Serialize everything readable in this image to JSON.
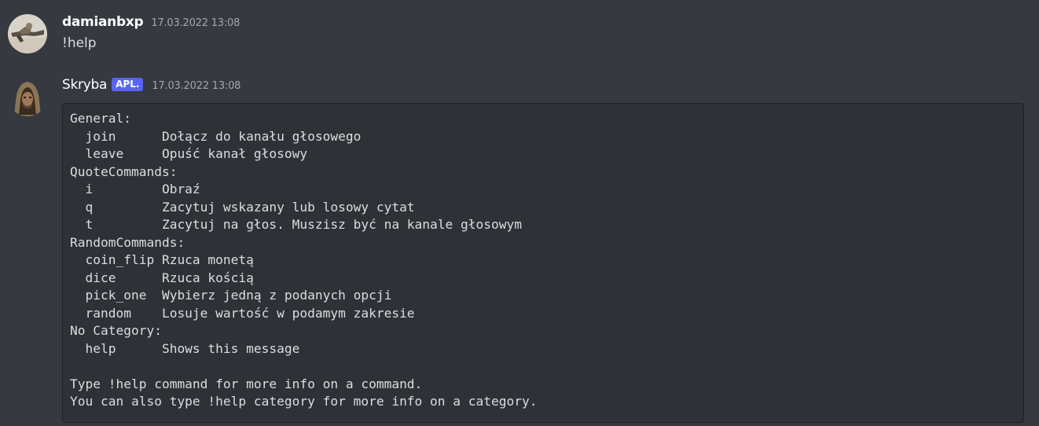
{
  "messages": [
    {
      "username": "damianbxp",
      "timestamp": "17.03.2022 13:08",
      "content": "!help",
      "avatar_icon": "user-avatar-icon"
    },
    {
      "username": "Skryba",
      "badge": "APL.",
      "timestamp": "17.03.2022 13:08",
      "avatar_icon": "bot-avatar-icon",
      "code": "General:\n  join      Dołącz do kanału głosowego\n  leave     Opuść kanał głosowy\nQuoteCommands:\n  i         Obraź\n  q         Zacytuj wskazany lub losowy cytat\n  t         Zacytuj na głos. Muszisz być na kanale głosowym\nRandomCommands:\n  coin_flip Rzuca monetą\n  dice      Rzuca kością\n  pick_one  Wybierz jedną z podanych opcji\n  random    Losuje wartość w podamym zakresie\nNo Category:\n  help      Shows this message\n\nType !help command for more info on a command.\nYou can also type !help category for more info on a category."
    }
  ],
  "colors": {
    "background": "#36393f",
    "codeblock_bg": "#2f3136",
    "badge": "#5865f2",
    "timestamp": "#a3a6aa",
    "text": "#dcddde"
  }
}
